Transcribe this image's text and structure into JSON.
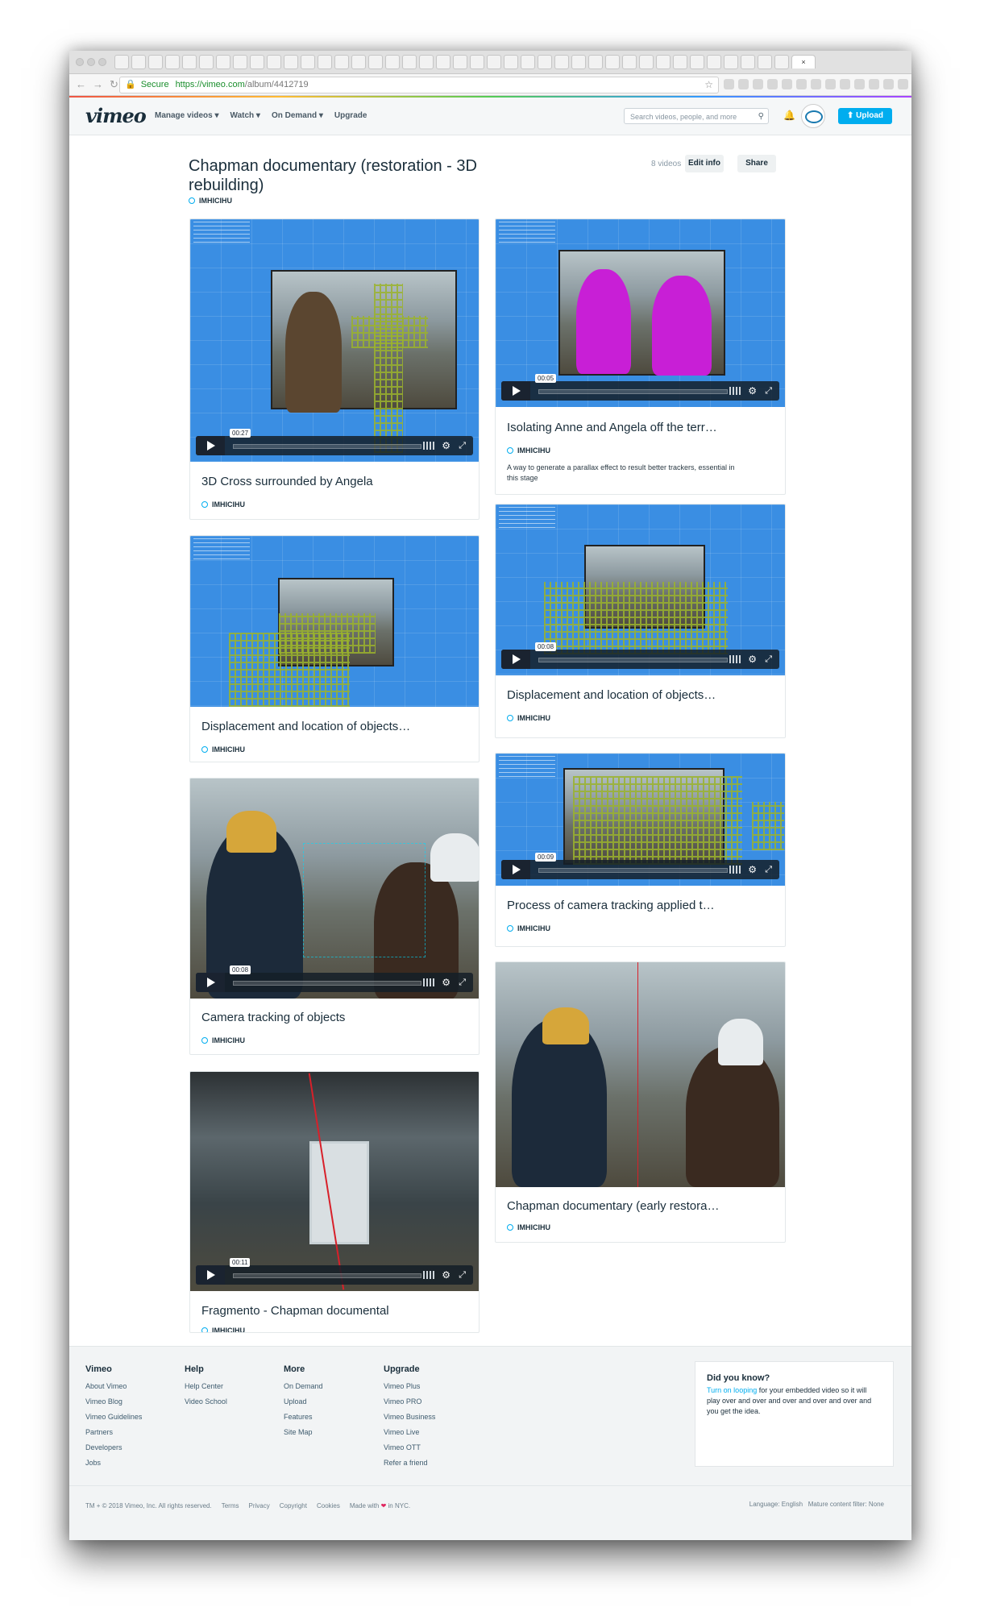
{
  "browser": {
    "address_secure": "Secure",
    "address_host": "https://vimeo.com",
    "address_path": "/album/4412719"
  },
  "header": {
    "logo": "vimeo",
    "nav": [
      "Manage videos ▾",
      "Watch ▾",
      "On Demand ▾",
      "Upgrade"
    ],
    "search_placeholder": "Search videos, people, and more",
    "upload_label": "Upload"
  },
  "album": {
    "title": "Chapman documentary (restoration - 3D rebuilding)",
    "owner": "IMHICIHU",
    "count": "8 videos",
    "edit_label": "Edit info",
    "share_label": "Share"
  },
  "videos": [
    {
      "title": "3D Cross surrounded by Angela",
      "owner": "IMHICIHU",
      "time": "00:27"
    },
    {
      "title": "Isolating Anne and Angela off the terr…",
      "owner": "IMHICIHU",
      "time": "00:05",
      "description": "A way to generate a parallax effect to result better trackers, essential in this stage"
    },
    {
      "title": "Displacement and location of objects…",
      "owner": "IMHICIHU"
    },
    {
      "title": "Displacement and location of objects…",
      "owner": "IMHICIHU",
      "time": "00:08"
    },
    {
      "title": "Camera tracking of objects",
      "owner": "IMHICIHU",
      "time": "00:08"
    },
    {
      "title": "Process of camera tracking applied t…",
      "owner": "IMHICIHU",
      "time": "00:09"
    },
    {
      "title": "Fragmento - Chapman documental",
      "owner": "IMHICIHU",
      "time": "00:11"
    },
    {
      "title": "Chapman documentary (early restora…",
      "owner": "IMHICIHU"
    }
  ],
  "footer": {
    "columns": [
      {
        "heading": "Vimeo",
        "links": [
          "About Vimeo",
          "Vimeo Blog",
          "Vimeo Guidelines",
          "Partners",
          "Developers",
          "Jobs"
        ]
      },
      {
        "heading": "Help",
        "links": [
          "Help Center",
          "Video School"
        ]
      },
      {
        "heading": "More",
        "links": [
          "On Demand",
          "Upload",
          "Features",
          "Site Map"
        ]
      },
      {
        "heading": "Upgrade",
        "links": [
          "Vimeo Plus",
          "Vimeo PRO",
          "Vimeo Business",
          "Vimeo Live",
          "Vimeo OTT",
          "Refer a friend"
        ]
      }
    ],
    "tip_heading": "Did you know?",
    "tip_link": "Turn on looping",
    "tip_text": " for your embedded video so it will play over and over and over and over and over and you get the idea.",
    "legal": [
      "TM + © 2018 Vimeo, Inc. All rights reserved.",
      "Terms",
      "Privacy",
      "Copyright",
      "Cookies"
    ],
    "made_with_prefix": "Made with",
    "made_with_suffix": "in NYC.",
    "language": "Language: English",
    "mature": "Mature content filter: None"
  },
  "colors": {
    "accent": "#00adef",
    "text": "#1a2e3b",
    "scene_blue": "#3a8ee3",
    "wireframe": "#9bb32d",
    "mask_magenta": "#c81fd6"
  }
}
